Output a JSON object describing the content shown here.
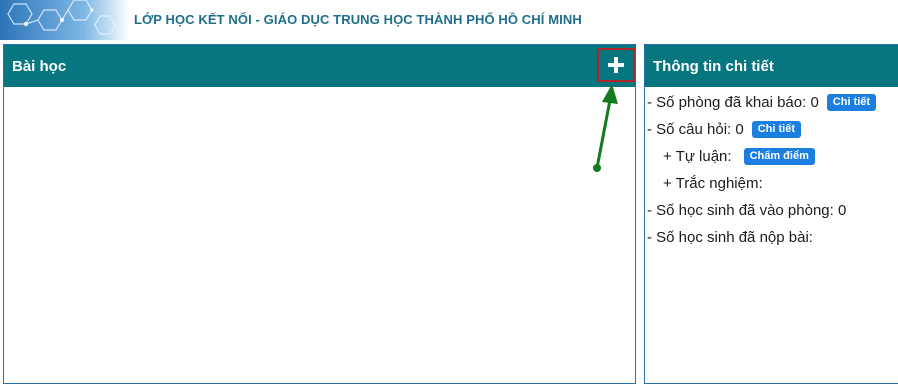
{
  "header": {
    "title": "LỚP HỌC KẾT NỐI -  GIÁO DỤC TRUNG HỌC THÀNH PHỐ HỒ CHÍ MINH"
  },
  "lessons_panel": {
    "title": "Bài học",
    "add_icon": "plus-icon"
  },
  "details_panel": {
    "title": "Thông tin chi tiết",
    "rows": [
      {
        "text": "- Số phòng đã khai báo: 0",
        "badge": "Chi tiết"
      },
      {
        "text": "- Số câu hỏi: 0",
        "badge": "Chi tiết"
      },
      {
        "text": "+ Tự luận:",
        "badge": "Chấm điểm"
      },
      {
        "text": "+ Trắc nghiệm:"
      },
      {
        "text": "- Số học sinh đã vào phòng: 0"
      },
      {
        "text": "- Số học sinh đã nộp bài:"
      }
    ]
  },
  "colors": {
    "header_teal": "#07767f",
    "title_blue": "#1f6e8c",
    "badge_blue": "#1a7fe0",
    "highlight_red": "#b0252a",
    "arrow_green": "#137a1e"
  }
}
